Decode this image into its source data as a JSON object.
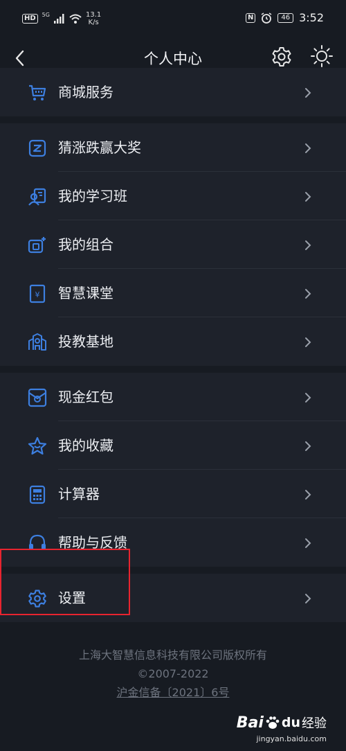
{
  "status_bar": {
    "hd": "HD",
    "network": "5G",
    "speed_value": "13.1",
    "speed_unit": "K/s",
    "nfc": "N",
    "battery": "46",
    "time": "3:52"
  },
  "nav": {
    "title": "个人中心",
    "icons": {
      "back": "back-arrow-icon",
      "settings": "gear-icon",
      "theme": "sun-icon"
    }
  },
  "groups": [
    {
      "items": [
        {
          "label": "商城服务",
          "icon": "cart-icon"
        }
      ]
    },
    {
      "items": [
        {
          "label": "猜涨跌赢大奖",
          "icon": "rise-fall-icon"
        },
        {
          "label": "我的学习班",
          "icon": "study-class-icon"
        },
        {
          "label": "我的组合",
          "icon": "portfolio-icon"
        },
        {
          "label": "智慧课堂",
          "icon": "smart-classroom-icon"
        },
        {
          "label": "投教基地",
          "icon": "education-base-icon"
        }
      ]
    },
    {
      "items": [
        {
          "label": "现金红包",
          "icon": "red-envelope-icon"
        },
        {
          "label": "我的收藏",
          "icon": "star-icon"
        },
        {
          "label": "计算器",
          "icon": "calculator-icon"
        },
        {
          "label": "帮助与反馈",
          "icon": "headset-icon"
        }
      ]
    },
    {
      "items": [
        {
          "label": "设置",
          "icon": "settings-gear-icon"
        }
      ]
    }
  ],
  "footer": {
    "copyright": "上海大智慧信息科技有限公司版权所有",
    "years": "©2007-2022",
    "icp": "沪金信备〔2021〕6号"
  },
  "watermark": {
    "brand_bai": "Bai",
    "brand_du": "du",
    "brand_cn": "经验",
    "url": "jingyan.baidu.com"
  },
  "colors": {
    "background": "#171b22",
    "row": "#1e222b",
    "icon_blue": "#3d7fe0",
    "highlight": "#e8242f"
  }
}
